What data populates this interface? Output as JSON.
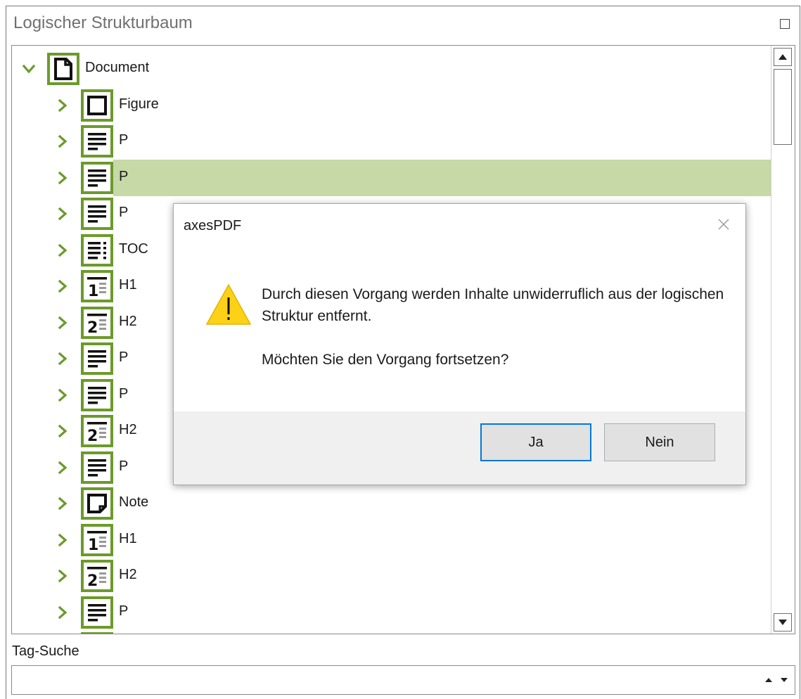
{
  "panel": {
    "title": "Logischer Strukturbaum",
    "maximize_icon": "maximize-icon"
  },
  "tree": {
    "accent_color": "#6c9a2b",
    "selected_color": "#c6d9a6",
    "root": {
      "label": "Document",
      "icon": "document-icon",
      "expanded": true
    },
    "items": [
      {
        "label": "Figure",
        "icon": "figure-icon"
      },
      {
        "label": "P",
        "icon": "paragraph-icon"
      },
      {
        "label": "P",
        "icon": "paragraph-icon",
        "selected": true
      },
      {
        "label": "P",
        "icon": "paragraph-icon"
      },
      {
        "label": "TOC",
        "icon": "toc-icon"
      },
      {
        "label": "H1",
        "icon": "heading1-icon"
      },
      {
        "label": "H2",
        "icon": "heading2-icon"
      },
      {
        "label": "P",
        "icon": "paragraph-icon"
      },
      {
        "label": "P",
        "icon": "paragraph-icon"
      },
      {
        "label": "H2",
        "icon": "heading2-icon"
      },
      {
        "label": "P",
        "icon": "paragraph-icon"
      },
      {
        "label": "Note",
        "icon": "note-icon"
      },
      {
        "label": "H1",
        "icon": "heading1-icon"
      },
      {
        "label": "H2",
        "icon": "heading2-icon"
      },
      {
        "label": "P",
        "icon": "paragraph-icon"
      },
      {
        "label": "",
        "icon": "paragraph-icon"
      }
    ]
  },
  "search": {
    "label": "Tag-Suche",
    "value": "",
    "placeholder": ""
  },
  "dialog": {
    "title": "axesPDF",
    "icon": "warning-icon",
    "message_line1": "Durch diesen Vorgang werden Inhalte unwiderruflich aus der logischen Struktur entfernt.",
    "message_line2": "Möchten Sie den Vorgang fortsetzen?",
    "yes_label": "Ja",
    "no_label": "Nein"
  }
}
